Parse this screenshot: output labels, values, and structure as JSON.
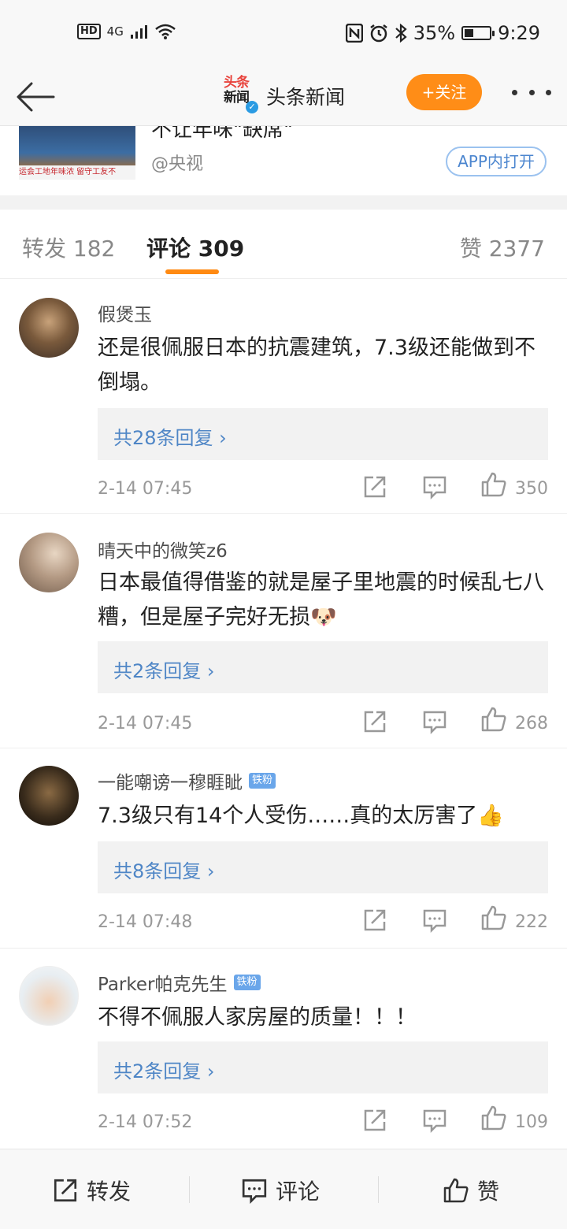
{
  "status_bar": {
    "hd": "HD",
    "network": "4G",
    "battery": "35%",
    "battery_level": 0.35,
    "time": "9:29"
  },
  "nav": {
    "logo_line1": "头条",
    "logo_line2": "新闻",
    "title": "头条新闻",
    "follow_label": "+关注"
  },
  "shared_post": {
    "title": "不让年味\"缺席\"",
    "source": "@央视",
    "thumb_caption": "运会工地年味浓 留守工友不",
    "app_open_label": "APP内打开"
  },
  "tabs": {
    "repost": "转发 182",
    "comments": "评论 309",
    "likes": "赞 2377"
  },
  "comments": [
    {
      "username": "假煲玉",
      "text": "还是很佩服日本的抗震建筑，7.3级还能做到不倒塌。",
      "replies": "共28条回复 ›",
      "time": "2-14 07:45",
      "likes": "350"
    },
    {
      "username": "晴天中的微笑z6",
      "text": "日本最值得借鉴的就是屋子里地震的时候乱七八糟，但是屋子完好无损🐶",
      "replies": "共2条回复 ›",
      "time": "2-14 07:45",
      "likes": "268"
    },
    {
      "username": "一能嘲谤一穆睚眦",
      "badge": "铁粉",
      "text": "7.3级只有14个人受伤……真的太厉害了👍",
      "replies": "共8条回复 ›",
      "time": "2-14 07:48",
      "likes": "222"
    },
    {
      "username": "Parker帕克先生",
      "badge": "铁粉",
      "text": "不得不佩服人家房屋的质量！！！",
      "replies": "共2条回复 ›",
      "time": "2-14 07:52",
      "likes": "109"
    }
  ],
  "toolbar": {
    "repost": "转发",
    "comment": "评论",
    "like": "赞"
  },
  "colors": {
    "accent_orange": "#ff8d17",
    "link_blue": "#4f86c6",
    "badge_blue": "#6aa6ea"
  }
}
